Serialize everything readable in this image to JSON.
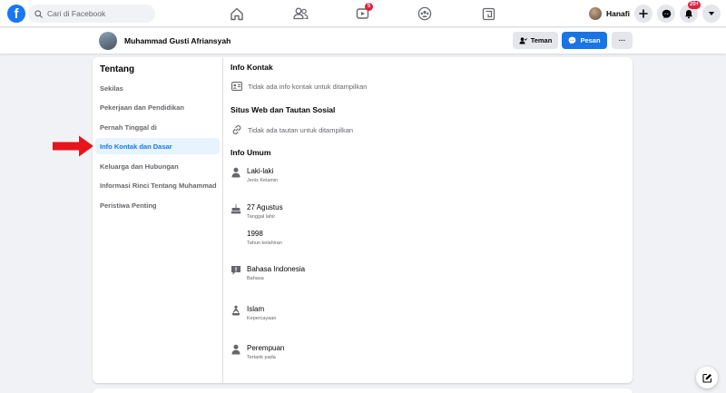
{
  "topbar": {
    "search_placeholder": "Cari di Facebook",
    "nav": {
      "watch_badge": "5"
    },
    "user_name": "Hanafi",
    "notifications_badge": "20+"
  },
  "profile": {
    "name": "Muhammad Gusti Afriansyah",
    "friend_button": "Teman",
    "message_button": "Pesan",
    "more_button": "···"
  },
  "sidebar": {
    "title": "Tentang",
    "items": [
      {
        "label": "Sekilas"
      },
      {
        "label": "Pekerjaan dan Pendidikan"
      },
      {
        "label": "Pernah Tinggal di"
      },
      {
        "label": "Info Kontak dan Dasar"
      },
      {
        "label": "Keluarga dan Hubungan"
      },
      {
        "label": "Informasi Rinci Tentang Muhammad"
      },
      {
        "label": "Peristiwa Penting"
      }
    ],
    "active_index": 3
  },
  "content": {
    "contact": {
      "title": "Info Kontak",
      "empty_text": "Tidak ada info kontak untuk ditampilkan"
    },
    "web": {
      "title": "Situs Web dan Tautan Sosial",
      "empty_text": "Tidak ada tautan untuk ditampilkan"
    },
    "general": {
      "title": "Info Umum",
      "gender": {
        "value": "Laki-laki",
        "label": "Jenis Kelamin"
      },
      "birth_date": {
        "value": "27 Agustus",
        "label": "Tanggal lahir"
      },
      "birth_year": {
        "value": "1998",
        "label": "Tahun kelahiran"
      },
      "language": {
        "value": "Bahasa Indonesia",
        "label": "Bahasa"
      },
      "religion": {
        "value": "Islam",
        "label": "Kepercayaan"
      },
      "interested_in": {
        "value": "Perempuan",
        "label": "Tertarik pada"
      }
    }
  },
  "colors": {
    "brand": "#1877f2",
    "badge": "#e41e3f",
    "annotation_arrow": "#e8141b"
  }
}
